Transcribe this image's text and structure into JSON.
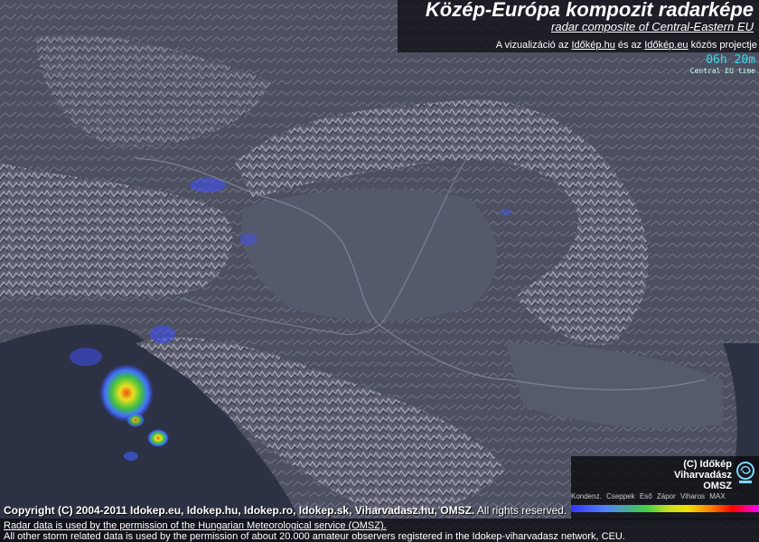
{
  "header": {
    "title": "Közép-Európa kompozit radarképe",
    "subtitle": "radar composite of Central-Eastern EU",
    "attribution_prefix": "A vizualizáció az ",
    "attribution_link1": "Időkép.hu",
    "attribution_mid": " és az ",
    "attribution_link2": "Időkép.eu",
    "attribution_suffix": " közös projectje"
  },
  "time": {
    "value": "06h 20m",
    "label": "Central EU time"
  },
  "legend": {
    "brand_line1": "(C) Időkép",
    "brand_line2": "Viharvadász",
    "brand_line3": "OMSZ",
    "labels": [
      "Kondenz.",
      "Cseppek",
      "Eső",
      "Zápor",
      "Viharos",
      "MAX"
    ],
    "colors": [
      "#3535ff",
      "#40d040",
      "#f0e000",
      "#ff8000",
      "#ff0000",
      "#ff00ff"
    ]
  },
  "footer": {
    "copyright_bold": "Copyright (C) 2004-2011  Idokep.eu, Idokep.hu, Idokep.ro, Idokep.sk, Viharvadasz.hu, OMSZ.",
    "copyright_rest": " All rights reserved.",
    "line2": "Radar data is used by the permission of the Hungarian Meteorological service (OMSZ).",
    "line3": "All other storm related data is used by the permission of about 20.000 amateur observers registered in the Idokep-viharvadasz network, CEU."
  }
}
